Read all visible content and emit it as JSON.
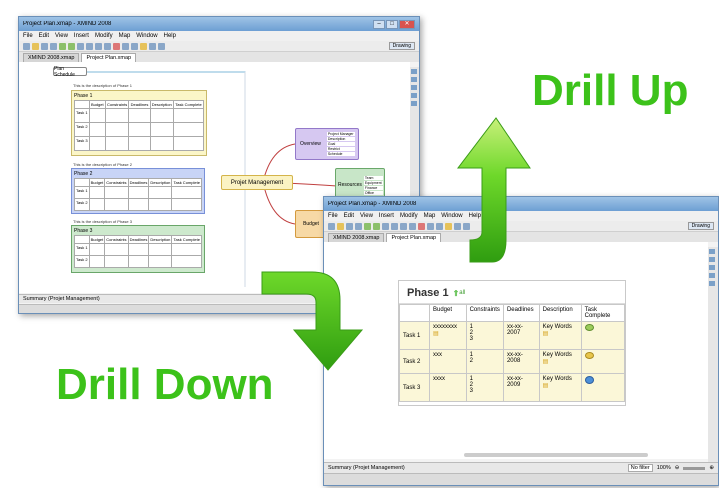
{
  "labels": {
    "drill_up": "Drill Up",
    "drill_down": "Drill Down"
  },
  "colors": {
    "arrow": "#5cd41e",
    "label": "#3cc21a"
  },
  "window1": {
    "title": "Project Plan.xmap - XMIND 2008",
    "menu": [
      "File",
      "Edit",
      "View",
      "Insert",
      "Modify",
      "Map",
      "Window",
      "Help"
    ],
    "drawing_label": "Drawing",
    "tabs": [
      "XMIND 2008.xmap",
      "Project Plan.xmap"
    ],
    "plan_schedule": "Plan Schedule",
    "phase_notes": [
      "This is the description of Phase 1",
      "This is the description of Phase 2",
      "This is the description of Phase 3"
    ],
    "phases": [
      "Phase 1",
      "Phase 2",
      "Phase 3"
    ],
    "columns": [
      "Budget",
      "Constraints",
      "Deadlines",
      "Description",
      "Task Complete"
    ],
    "rows": [
      "Task 1",
      "Task 2",
      "Task 3"
    ],
    "central": "Projet Management",
    "overview": "Overview",
    "resources": "Resources",
    "budget": "Budget",
    "overview_items": [
      "Project Manager",
      "Description",
      "Goal",
      "Restrict",
      "Schedule"
    ],
    "resource_items": [
      "Team",
      "Equipment",
      "Finance",
      "Office"
    ],
    "summary": "Summary (Projet Management)"
  },
  "window2": {
    "title": "Project Plan.xmap - XMIND 2008",
    "menu": [
      "File",
      "Edit",
      "View",
      "Insert",
      "Modify",
      "Map",
      "Window",
      "Help"
    ],
    "drawing_label": "Drawing",
    "tabs": [
      "XMIND 2008.xmap",
      "Project Plan.xmap"
    ],
    "phase_title": "Phase 1",
    "up_link": "all",
    "columns": [
      "Budget",
      "Constraints",
      "Deadlines",
      "Description",
      "Task Complete"
    ],
    "rows": [
      {
        "task": "Task 1",
        "budget": "xxxxxxxx",
        "constraints": "1\n2\n3",
        "deadline": "xx-xx-2007",
        "description": "Key Words"
      },
      {
        "task": "Task 2",
        "budget": "xxx",
        "constraints": "1\n2",
        "deadline": "xx-xx-2008",
        "description": "Key Words"
      },
      {
        "task": "Task 3",
        "budget": "xxxx",
        "constraints": "1\n2\n3",
        "deadline": "xx-xx-2009",
        "description": "Key Words"
      }
    ],
    "summary": "Summary (Projet Management)",
    "filter": "No filter",
    "zoom": "100%"
  }
}
